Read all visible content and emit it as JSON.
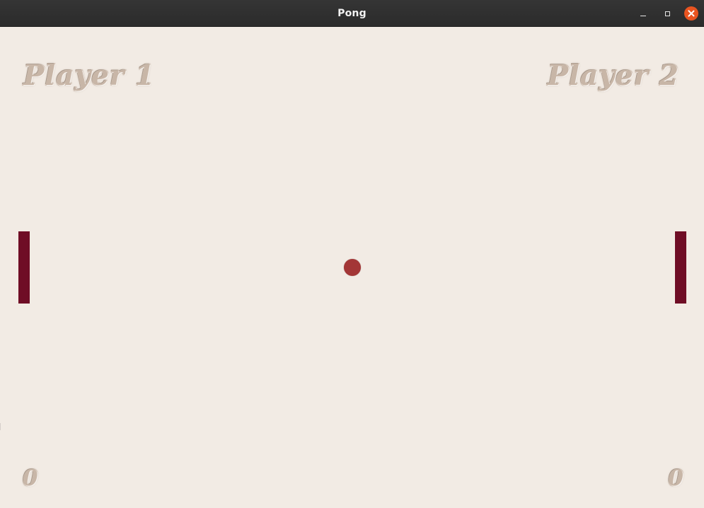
{
  "window": {
    "title": "Pong",
    "controls": {
      "minimize_icon": "minimize-icon",
      "maximize_icon": "maximize-icon",
      "close_icon": "close-icon"
    }
  },
  "game": {
    "player_1_label": "Player 1",
    "player_2_label": "Player 2",
    "player_1_score": "0",
    "player_2_score": "0",
    "colors": {
      "background": "#f2ebe4",
      "paddle": "#6f0d25",
      "ball": "#a33636",
      "label": "#c8b6a7"
    }
  }
}
